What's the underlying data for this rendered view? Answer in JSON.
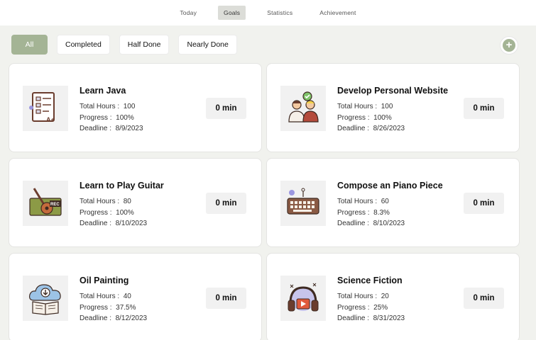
{
  "nav": {
    "tabs": [
      {
        "label": "Today"
      },
      {
        "label": "Goals"
      },
      {
        "label": "Statistics"
      },
      {
        "label": "Achievement"
      }
    ]
  },
  "filters": [
    {
      "label": "All"
    },
    {
      "label": "Completed"
    },
    {
      "label": "Half Done"
    },
    {
      "label": "Nearly Done"
    }
  ],
  "add_button": {
    "label": "+"
  },
  "goals": [
    {
      "title": "Learn Java",
      "hours_label": "Total Hours :",
      "hours": "100",
      "progress_label": "Progress :",
      "progress": "100%",
      "deadline_label": "Deadline :",
      "deadline": "8/9/2023",
      "time": "0 min",
      "icon": "exam-paper-icon"
    },
    {
      "title": "Develop Personal Website",
      "hours_label": "Total Hours :",
      "hours": "100",
      "progress_label": "Progress :",
      "progress": "100%",
      "deadline_label": "Deadline :",
      "deadline": "8/26/2023",
      "time": "0 min",
      "icon": "team-check-icon"
    },
    {
      "title": "Learn to Play Guitar",
      "hours_label": "Total Hours :",
      "hours": "80",
      "progress_label": "Progress :",
      "progress": "100%",
      "deadline_label": "Deadline :",
      "deadline": "8/10/2023",
      "time": "0 min",
      "icon": "guitar-rec-icon",
      "badge": "REC"
    },
    {
      "title": "Compose an Piano Piece",
      "hours_label": "Total Hours :",
      "hours": "60",
      "progress_label": "Progress :",
      "progress": "8.3%",
      "deadline_label": "Deadline :",
      "deadline": "8/10/2023",
      "time": "0 min",
      "icon": "keyboard-icon"
    },
    {
      "title": "Oil Painting",
      "hours_label": "Total Hours :",
      "hours": "40",
      "progress_label": "Progress :",
      "progress": "37.5%",
      "deadline_label": "Deadline :",
      "deadline": "8/12/2023",
      "time": "0 min",
      "icon": "cloud-book-icon"
    },
    {
      "title": "Science Fiction",
      "hours_label": "Total Hours :",
      "hours": "20",
      "progress_label": "Progress :",
      "progress": "25%",
      "deadline_label": "Deadline :",
      "deadline": "8/31/2023",
      "time": "0 min",
      "icon": "headphones-play-icon"
    }
  ],
  "colors": {
    "accent": "#a4b495",
    "background": "#f1f2ee",
    "card": "#ffffff"
  }
}
